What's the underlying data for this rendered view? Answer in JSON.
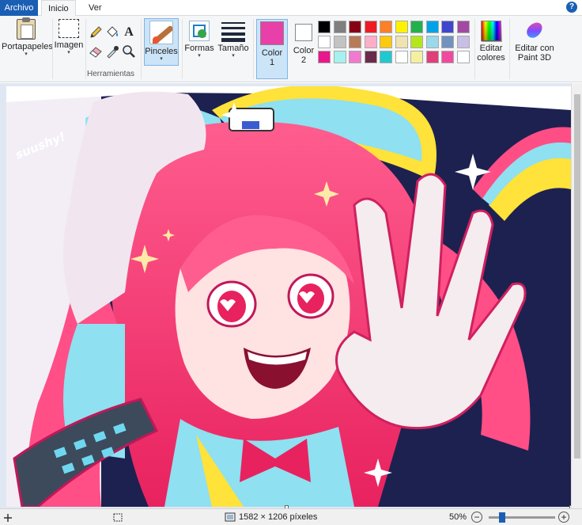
{
  "tabs": {
    "file": "Archivo",
    "home": "Inicio",
    "view": "Ver",
    "help": "?"
  },
  "ribbon": {
    "clipboard": {
      "label": "Portapapeles",
      "arrow": "▾"
    },
    "image": {
      "label": "Imagen",
      "arrow": "▾"
    },
    "tools": {
      "group_label": "Herramientas",
      "text_tool": "A"
    },
    "brushes": {
      "label": "Pinceles",
      "arrow": "▾"
    },
    "shapes": {
      "label": "Formas",
      "arrow": "▾"
    },
    "size": {
      "label": "Tamaño",
      "arrow": "▾"
    },
    "color1": {
      "label_line1": "Color",
      "label_line2": "1",
      "value": "#e83fa8"
    },
    "color2": {
      "label_line1": "Color",
      "label_line2": "2",
      "value": "#ffffff"
    },
    "palette": [
      "#000000",
      "#7f7f7f",
      "#880015",
      "#ed1c24",
      "#ff7f27",
      "#fff200",
      "#22b14c",
      "#00a2e8",
      "#3f48cc",
      "#a349a4",
      "#ffffff",
      "#c3c3c3",
      "#b97a57",
      "#ffaec9",
      "#ffc90e",
      "#efe4b0",
      "#b5e61d",
      "#99d9ea",
      "#7092be",
      "#c8bfe7",
      "#e8178c",
      "#a6f0f0",
      "#f07ad0",
      "#6a2b4a",
      "#20c8d0",
      "#ffffff",
      "#f5f0a0",
      "#e0407a",
      "#f04aa0",
      "#ffffff"
    ],
    "edit_colors": {
      "label_line1": "Editar",
      "label_line2": "colores"
    },
    "paint3d": {
      "label_line1": "Editar con",
      "label_line2": "Paint 3D"
    }
  },
  "artwork": {
    "signature": "suushy!"
  },
  "statusbar": {
    "dimensions": "1582 × 1206 píxeles",
    "zoom": "50%",
    "zoom_fraction": 0.2,
    "zoom_out": "−",
    "zoom_in": "+"
  }
}
